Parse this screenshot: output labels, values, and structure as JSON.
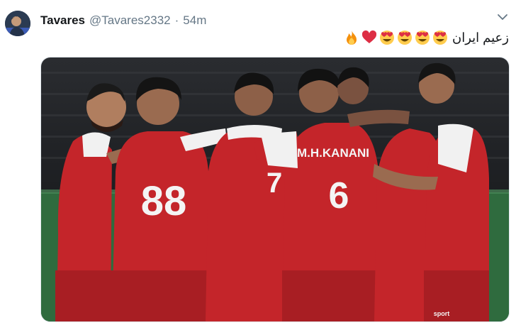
{
  "tweet": {
    "author_name": "Tavares",
    "handle": "@Tavares2332",
    "separator": "·",
    "timestamp": "54m",
    "text": "زعیم ایران",
    "emojis": [
      "fire-emoji",
      "red-heart-emoji",
      "heart-eyes-emoji",
      "heart-eyes-emoji",
      "heart-eyes-emoji",
      "heart-eyes-emoji"
    ]
  },
  "media": {
    "jersey_name": "M.H.KANANI",
    "jersey_numbers": [
      "88",
      "6"
    ],
    "kit_badge": "sport",
    "colors": {
      "kit_red": "#c4252a",
      "kit_white": "#f1f1f1",
      "pitch_green": "#2f6b3e",
      "stands": "#1d1f22"
    }
  }
}
